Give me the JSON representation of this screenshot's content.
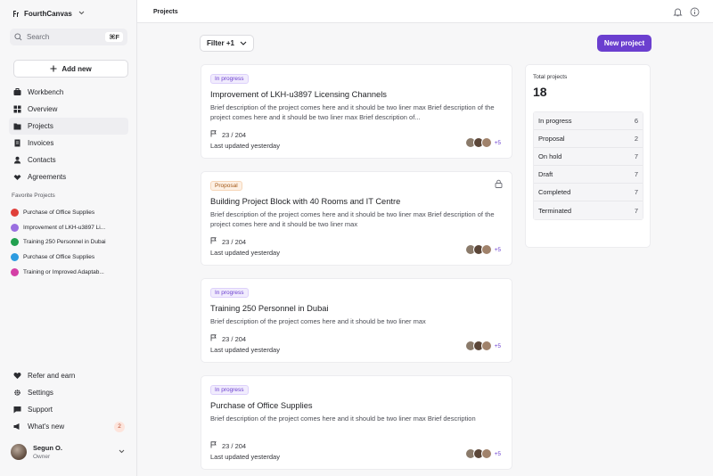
{
  "app": {
    "name": "FourthCanvas",
    "search_placeholder": "Search",
    "search_shortcut": "⌘F",
    "add_new_label": "Add new"
  },
  "sidebar": {
    "items": [
      {
        "label": "Workbench",
        "icon": "workbench-icon"
      },
      {
        "label": "Overview",
        "icon": "grid-icon"
      },
      {
        "label": "Projects",
        "icon": "folder-icon",
        "active": true
      },
      {
        "label": "Invoices",
        "icon": "document-icon"
      },
      {
        "label": "Contacts",
        "icon": "user-icon"
      },
      {
        "label": "Agreements",
        "icon": "handshake-icon"
      }
    ],
    "favorites_title": "Favorite Projects",
    "favorites": [
      {
        "label": "Purchase of Office Supplies",
        "color": "#e0403a"
      },
      {
        "label": "Improvement of LKH-u3897 Li...",
        "color": "#9a6fe0"
      },
      {
        "label": "Training 250 Personnel in Dubai",
        "color": "#21a04f"
      },
      {
        "label": "Purchase of Office Supplies",
        "color": "#2d9be0"
      },
      {
        "label": "Training or Improved Adaptab...",
        "color": "#d43fa6"
      }
    ],
    "bottom_items": [
      {
        "label": "Refer and earn",
        "icon": "heart-icon"
      },
      {
        "label": "Settings",
        "icon": "gear-icon"
      },
      {
        "label": "Support",
        "icon": "chat-icon"
      },
      {
        "label": "What's new",
        "icon": "megaphone-icon",
        "badge": "2"
      }
    ],
    "user": {
      "name": "Segun O.",
      "role": "Owner"
    }
  },
  "header": {
    "title": "Projects"
  },
  "toolbar": {
    "filter_label": "Filter +1",
    "new_project_label": "New project"
  },
  "projects": [
    {
      "status": "In progress",
      "title": "Improvement of LKH-u3897 Licensing Channels",
      "description": "Brief description of the project comes here and it should be two liner max Brief description of the project comes here and it should be two liner max Brief description of...",
      "progress": "23 / 204",
      "updated": "Last updated yesterday",
      "more_members": "+5"
    },
    {
      "status": "Proposal",
      "title": "Building Project Block with 40 Rooms and IT Centre",
      "description": "Brief description of the project comes here and it should be two liner max Brief description of the project comes here and it should be two liner max",
      "progress": "23 / 204",
      "updated": "Last updated yesterday",
      "more_members": "+5",
      "locked": true
    },
    {
      "status": "In progress",
      "title": "Training 250 Personnel in Dubai",
      "description": "Brief description of the project comes here and it should be two liner max",
      "progress": "23 / 204",
      "updated": "Last updated yesterday",
      "more_members": "+5"
    },
    {
      "status": "In progress",
      "title": "Purchase of Office Supplies",
      "description": "Brief description of the project comes here and it should be two liner max Brief description",
      "progress": "23 / 204",
      "updated": "Last updated yesterday",
      "more_members": "+5"
    }
  ],
  "stats": {
    "label": "Total projects",
    "total": "18",
    "breakdown": [
      {
        "label": "In progress",
        "value": "6"
      },
      {
        "label": "Proposal",
        "value": "2"
      },
      {
        "label": "On hold",
        "value": "7"
      },
      {
        "label": "Draft",
        "value": "7"
      },
      {
        "label": "Completed",
        "value": "7"
      },
      {
        "label": "Terminated",
        "value": "7"
      }
    ]
  },
  "colors": {
    "accent": "#6b3fcf"
  }
}
